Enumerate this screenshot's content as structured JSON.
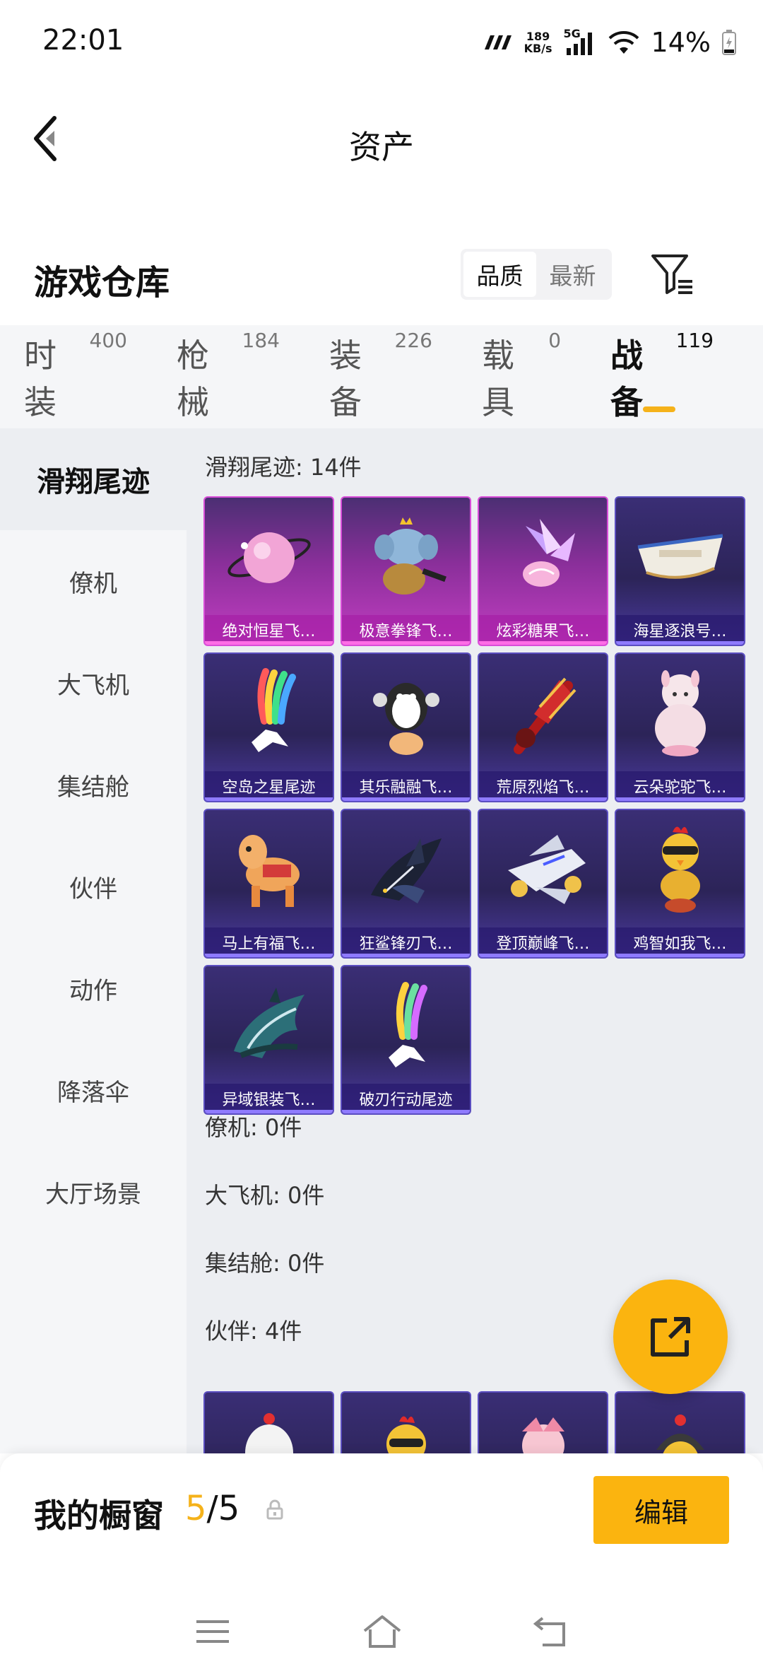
{
  "status_bar": {
    "time": "22:01",
    "net_speed_value": "189",
    "net_speed_unit": "KB/s",
    "network": "5G",
    "battery": "14%",
    "icons": [
      "carrier-icon",
      "signal-icon",
      "wifi-icon",
      "battery-icon"
    ]
  },
  "header": {
    "title": "资产",
    "back_icon": "back-arrow-icon"
  },
  "section": {
    "title": "游戏仓库",
    "sort_options": [
      "品质",
      "最新"
    ],
    "sort_selected": "品质",
    "filter_icon": "filter-icon"
  },
  "categories": [
    {
      "label": "时装",
      "count": "400"
    },
    {
      "label": "枪械",
      "count": "184"
    },
    {
      "label": "装备",
      "count": "226"
    },
    {
      "label": "载具",
      "count": "0"
    },
    {
      "label": "战备",
      "count": "119",
      "active": true
    }
  ],
  "sidebar": {
    "items": [
      {
        "label": "滑翔尾迹",
        "active": true
      },
      {
        "label": "僚机"
      },
      {
        "label": "大飞机"
      },
      {
        "label": "集结舱"
      },
      {
        "label": "伙伴"
      },
      {
        "label": "动作"
      },
      {
        "label": "降落伞"
      },
      {
        "label": "大厅场景"
      }
    ]
  },
  "groups": {
    "glide": {
      "title": "滑翔尾迹: 14件",
      "items": [
        {
          "name": "绝对恒星飞…",
          "rarity": "pink",
          "icon": "planet-icon"
        },
        {
          "name": "极意拳锋飞…",
          "rarity": "pink",
          "icon": "elephant-icon"
        },
        {
          "name": "炫彩糖果飞…",
          "rarity": "pink",
          "icon": "candy-icon"
        },
        {
          "name": "海星逐浪号…",
          "rarity": "purple",
          "icon": "boat-icon"
        },
        {
          "name": "空岛之星尾迹",
          "rarity": "purple",
          "icon": "smoke-trail-icon"
        },
        {
          "name": "其乐融融飞…",
          "rarity": "purple",
          "icon": "penguin-icon"
        },
        {
          "name": "荒原烈焰飞…",
          "rarity": "purple",
          "icon": "guitar-icon"
        },
        {
          "name": "云朵驼驼飞…",
          "rarity": "purple",
          "icon": "alpaca-icon"
        },
        {
          "name": "马上有福飞…",
          "rarity": "purple",
          "icon": "horse-icon"
        },
        {
          "name": "狂鲨锋刃飞…",
          "rarity": "purple",
          "icon": "shark-icon"
        },
        {
          "name": "登顶巅峰飞…",
          "rarity": "purple",
          "icon": "jet-icon"
        },
        {
          "name": "鸡智如我飞…",
          "rarity": "purple",
          "icon": "chicken-icon"
        },
        {
          "name": "异域银装飞…",
          "rarity": "purple",
          "icon": "wing-icon"
        },
        {
          "name": "破刃行动尾迹",
          "rarity": "purple",
          "icon": "smoke-trail-icon"
        }
      ]
    },
    "wingman": {
      "title": "僚机: 0件"
    },
    "plane": {
      "title": "大飞机: 0件"
    },
    "capsule": {
      "title": "集结舱: 0件"
    },
    "partner": {
      "title": "伙伴: 4件"
    }
  },
  "fab": {
    "icon": "share-icon"
  },
  "showcase": {
    "label": "我的橱窗",
    "current": "5",
    "total": "/5",
    "edit_label": "编辑",
    "lock_icon": "lock-icon"
  },
  "nav": {
    "icons": [
      "menu-icon",
      "home-icon",
      "back-icon"
    ]
  },
  "colors": {
    "accent": "#fbb40f",
    "underline": "#f5b21a",
    "rarity_pink": "#d84ed8",
    "rarity_purple": "#5b4ec0"
  }
}
